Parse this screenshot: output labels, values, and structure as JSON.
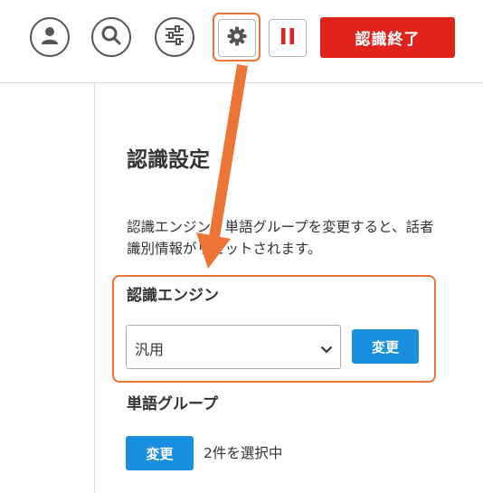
{
  "colors": {
    "accent_orange": "#ec7535",
    "end_red": "#e0241b",
    "pause_red": "#e02020",
    "button_blue": "#1a8fe0",
    "icon_gray": "#555555"
  },
  "toolbar": {
    "icons": [
      "user-icon",
      "search-icon",
      "sliders-icon",
      "gear-icon",
      "pause-icon"
    ],
    "end_label": "認識終了"
  },
  "settings": {
    "title": "認識設定",
    "description": "認識エンジン・単語グループを変更すると、話者識別情報がリセットされます。",
    "engine": {
      "label": "認識エンジン",
      "selected": "汎用",
      "change_label": "変更"
    },
    "word_group": {
      "label": "単語グループ",
      "change_label": "変更",
      "status": "2件を選択中"
    }
  }
}
